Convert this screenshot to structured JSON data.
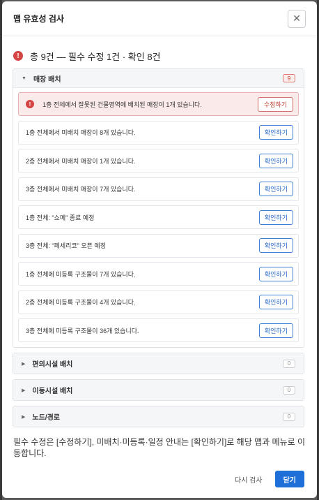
{
  "dialog": {
    "title": "맵 유효성 검사",
    "close_glyph": "✕"
  },
  "summary": {
    "icon": "!",
    "text": "총 9건 — 필수 수정 1건 · 확인 8건"
  },
  "sections": [
    {
      "title": "매장 배치",
      "count": "9",
      "expanded": true,
      "issues": [
        {
          "text": "1층 전체에서 잘못된 건물영역에 배치된 매장이 1개 있습니다.",
          "action": "수정하기",
          "severity": "error"
        },
        {
          "text": "1층 전체에서 미배치 매장이 8개 있습니다.",
          "action": "확인하기",
          "severity": "info"
        },
        {
          "text": "2층 전체에서 미배치 매장이 1개 있습니다.",
          "action": "확인하기",
          "severity": "info"
        },
        {
          "text": "3층 전체에서 미배치 매장이 7개 있습니다.",
          "action": "확인하기",
          "severity": "info"
        },
        {
          "text": "1층 전체: \"쇼메\" 종료 예정",
          "action": "확인하기",
          "severity": "info"
        },
        {
          "text": "3층 전체: \"페세리코\" 오픈 예정",
          "action": "확인하기",
          "severity": "info"
        },
        {
          "text": "1층 전체에 미등록 구조물이 7개 있습니다.",
          "action": "확인하기",
          "severity": "info"
        },
        {
          "text": "2층 전체에 미등록 구조물이 4개 있습니다.",
          "action": "확인하기",
          "severity": "info"
        },
        {
          "text": "3층 전체에 미등록 구조물이 36개 있습니다.",
          "action": "확인하기",
          "severity": "info"
        }
      ]
    },
    {
      "title": "편의시설 배치",
      "count": "0",
      "expanded": false
    },
    {
      "title": "이동시설 배치",
      "count": "0",
      "expanded": false
    },
    {
      "title": "노드/경로",
      "count": "0",
      "expanded": false
    }
  ],
  "footnote": "필수 수정은 [수정하기], 미배치·미등록·일정 안내는 [확인하기]로 해당 맵과 메뉴로 이동합니다.",
  "footer": {
    "recheck_label": "다시 검사",
    "close_label": "닫기"
  },
  "colors": {
    "primary": "#1f6fd8",
    "error": "#d64545",
    "error_bg": "#fbeaea"
  }
}
